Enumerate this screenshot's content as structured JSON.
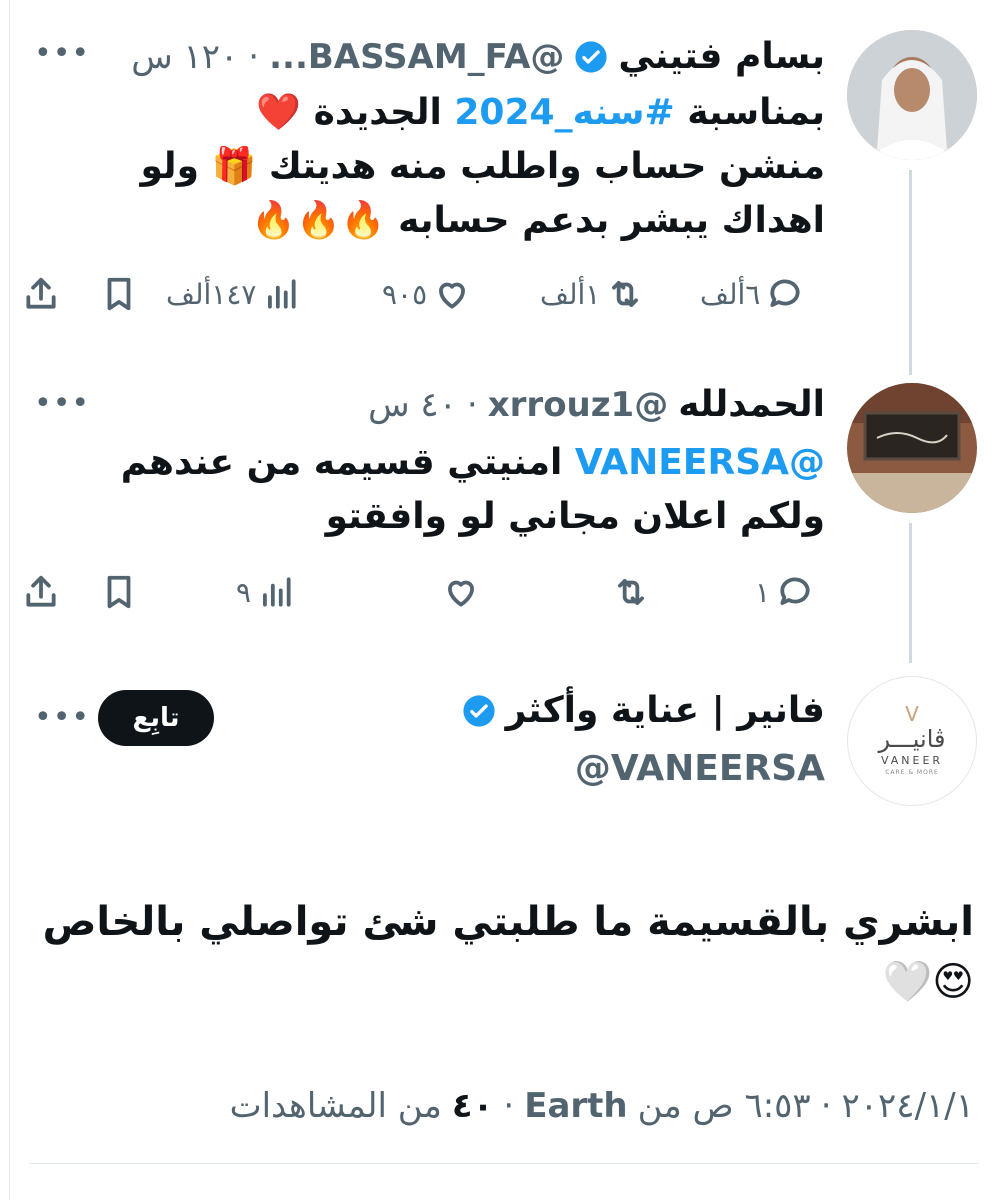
{
  "left_edge_line": true,
  "tweet1": {
    "name": "بسام فتيني",
    "handle": "@BASSAM_FA...",
    "time": "١٢٠ س",
    "line1_before": "بمناسبة ",
    "line1_hashtag": "#سنه_2024",
    "line1_after": " الجديدة ❤️",
    "line2": "منشن حساب واطلب منه هديتك 🎁 ولو",
    "line3": "اهداك يبشر بدعم حسابه 🔥🔥🔥",
    "replies": "٦ألف",
    "retweets": "١ألف",
    "likes": "٩٠٥",
    "views": "١٤٧ألف"
  },
  "tweet2": {
    "name": "الحمدلله",
    "handle": "@xrrouz1",
    "time": "٤٠ س",
    "mention": "@VANEERSA",
    "line1_rest": " امنيتي قسيمه من عندهم",
    "line2": "ولكم اعلان مجاني لو وافقتو",
    "replies": "١",
    "retweets": "",
    "likes": "",
    "views": "٩"
  },
  "main": {
    "name": "فانير | عناية وأكثر",
    "handle": "@VANEERSA",
    "follow_label": "تابِع",
    "avatar_text_ar": "ڤانيـــر",
    "avatar_text_en": "VANEER",
    "avatar_sub": "CARE & MORE",
    "body_line1": "ابشري بالقسيمة ما طلبتي شئ تواصلي بالخاص",
    "body_line2": "😍🤍",
    "date": "٢٠٢٤/١/١",
    "separator": "·",
    "time": "٦:٥٣ ص من",
    "source": "Earth",
    "views_count": "٤٠",
    "views_label": "من المشاهدات"
  },
  "colors": {
    "link": "#1d9bf0",
    "text": "#0f1419",
    "muted": "#536471",
    "line": "#cfd9de"
  },
  "icons": [
    "more-icon",
    "verified-icon",
    "reply-icon",
    "retweet-icon",
    "like-icon",
    "views-icon",
    "bookmark-icon",
    "share-icon"
  ]
}
